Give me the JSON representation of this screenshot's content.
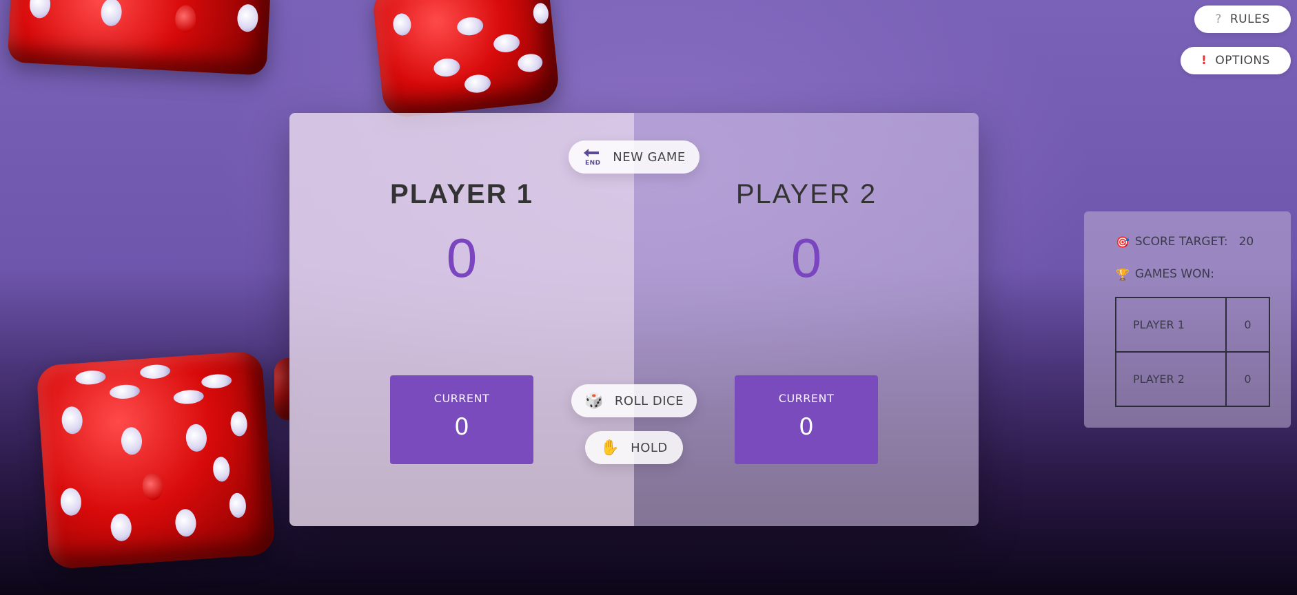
{
  "header": {
    "rules_label": "RULES",
    "rules_icon": "question-icon",
    "options_label": "OPTIONS",
    "options_icon": "exclamation-icon"
  },
  "board": {
    "new_game_label": "NEW GAME",
    "new_game_icon": "end-arrow-icon",
    "roll_label": "ROLL DICE",
    "roll_icon": "dice-icon",
    "hold_label": "HOLD",
    "hold_icon": "raised-hand-icon",
    "players": [
      {
        "name": "PLAYER 1",
        "score": "0",
        "current_label": "CURRENT",
        "current_value": "0",
        "active": true
      },
      {
        "name": "PLAYER 2",
        "score": "0",
        "current_label": "CURRENT",
        "current_value": "0",
        "active": false
      }
    ]
  },
  "side_panel": {
    "score_target_label": "SCORE TARGET:",
    "score_target_value": "20",
    "score_target_icon": "target-icon",
    "games_won_label": "GAMES WON:",
    "games_won_icon": "trophy-icon",
    "games_won": [
      {
        "player": "PLAYER 1",
        "wins": "0"
      },
      {
        "player": "PLAYER 2",
        "wins": "0"
      }
    ]
  },
  "colors": {
    "accent": "#7a4bbd",
    "score_text": "#7b45c0"
  }
}
